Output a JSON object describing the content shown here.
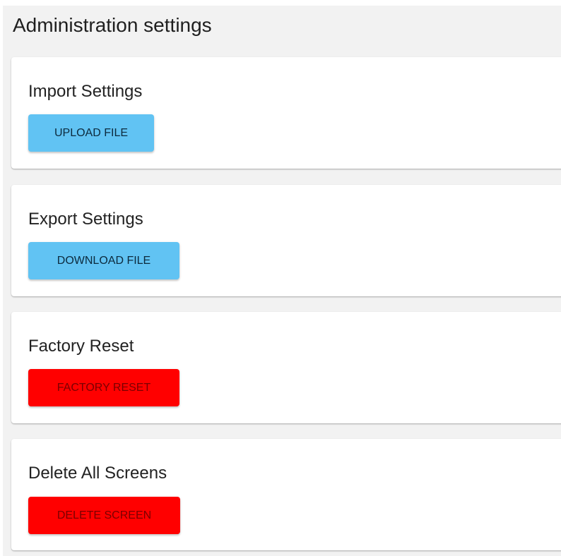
{
  "page": {
    "title": "Administration settings"
  },
  "sections": [
    {
      "title": "Import Settings",
      "button_label": "UPLOAD FILE",
      "button_color": "#61c3f3"
    },
    {
      "title": "Export Settings",
      "button_label": "DOWNLOAD FILE",
      "button_color": "#61c3f3"
    },
    {
      "title": "Factory Reset",
      "button_label": "FACTORY RESET",
      "button_color": "#ff0000"
    },
    {
      "title": "Delete All Screens",
      "button_label": "DELETE SCREEN",
      "button_color": "#ff0000"
    }
  ]
}
